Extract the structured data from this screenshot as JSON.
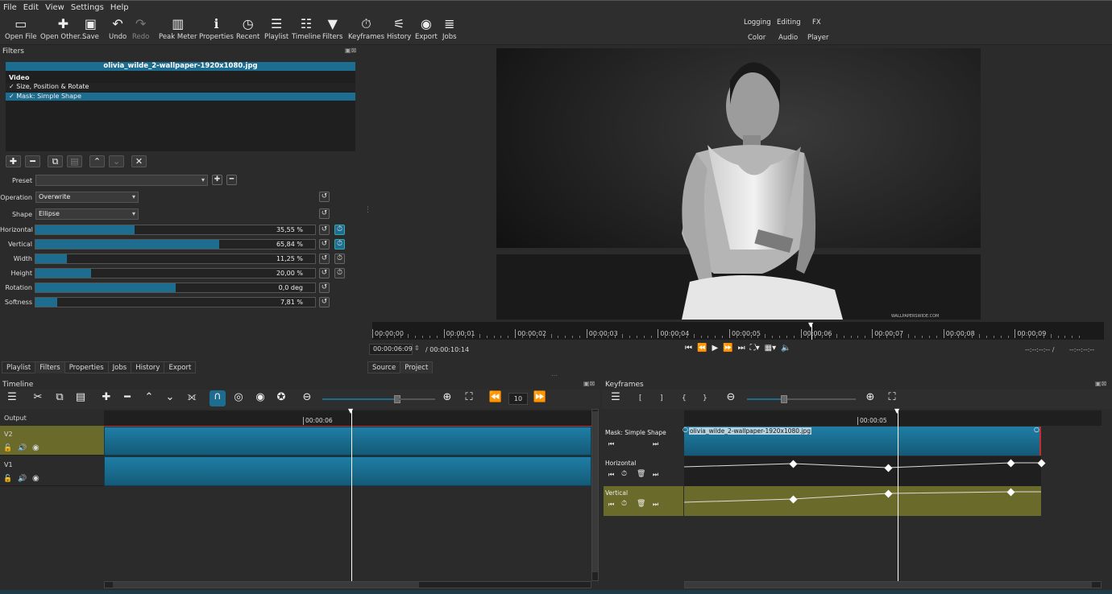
{
  "menu": [
    "File",
    "Edit",
    "View",
    "Settings",
    "Help"
  ],
  "toolbar": [
    {
      "label": "Open File",
      "icon": "open-file-icon"
    },
    {
      "label": "Open Other...",
      "icon": "open-other-icon"
    },
    {
      "label": "Save",
      "icon": "save-icon"
    },
    {
      "label": "Undo",
      "icon": "undo-icon"
    },
    {
      "label": "Redo",
      "icon": "redo-icon"
    },
    {
      "label": "Peak Meter",
      "icon": "peak-meter-icon"
    },
    {
      "label": "Properties",
      "icon": "info-icon"
    },
    {
      "label": "Recent",
      "icon": "clock-icon"
    },
    {
      "label": "Playlist",
      "icon": "playlist-icon"
    },
    {
      "label": "Timeline",
      "icon": "timeline-icon"
    },
    {
      "label": "Filters",
      "icon": "filter-icon"
    },
    {
      "label": "Keyframes",
      "icon": "stopwatch-icon"
    },
    {
      "label": "History",
      "icon": "history-icon"
    },
    {
      "label": "Export",
      "icon": "export-icon"
    },
    {
      "label": "Jobs",
      "icon": "jobs-icon"
    }
  ],
  "workspaces": {
    "row1": [
      "Logging",
      "Editing",
      "FX"
    ],
    "row2": [
      "Color",
      "Audio",
      "Player"
    ]
  },
  "filters": {
    "title": "Filters",
    "clip_name": "olivia_wilde_2-wallpaper-1920x1080.jpg",
    "section": "Video",
    "items": [
      {
        "label": "Size, Position & Rotate",
        "checked": true
      },
      {
        "label": "Mask: Simple Shape",
        "checked": true
      }
    ],
    "preset_label": "Preset",
    "preset_value": "",
    "operation_label": "Operation",
    "operation_value": "Overwrite",
    "shape_label": "Shape",
    "shape_value": "Ellipse",
    "sliders": [
      {
        "label": "Horizontal",
        "value": "35,55 %",
        "level": 0.3555,
        "keyframed": true
      },
      {
        "label": "Vertical",
        "value": "65,84 %",
        "level": 0.6584,
        "keyframed": true
      },
      {
        "label": "Width",
        "value": "11,25 %",
        "level": 0.1125,
        "keyframed": false
      },
      {
        "label": "Height",
        "value": "20,00 %",
        "level": 0.2,
        "keyframed": false
      },
      {
        "label": "Rotation",
        "value": "0,0 deg",
        "level": 0.5,
        "keyframed": null
      },
      {
        "label": "Softness",
        "value": "7,81 %",
        "level": 0.0781,
        "keyframed": null
      }
    ]
  },
  "left_tabs": [
    "Playlist",
    "Filters",
    "Properties",
    "Jobs",
    "History",
    "Export"
  ],
  "left_tab_active": "Filters",
  "player": {
    "ruler": [
      "00:00:00",
      "00:00:01",
      "00:00:02",
      "00:00:03",
      "00:00:04",
      "00:00:05",
      "00:00:06",
      "00:00:07",
      "00:00:08",
      "00:00:09"
    ],
    "position": "00:00:06:09",
    "duration": "/ 00:00:10:14",
    "in_point": "--:--:--:-- /",
    "out_point": "--:--:--:--",
    "tabs": [
      "Source",
      "Project"
    ],
    "watermark": "WALLPAPERSWIDE.COM"
  },
  "timeline": {
    "title": "Timeline",
    "zoom_value": "10",
    "output_label": "Output",
    "timecode": "00:00:06",
    "tracks": [
      "V2",
      "V1"
    ]
  },
  "keyframes": {
    "title": "Keyframes",
    "timecode": "00:00:05",
    "brackets": [
      "[",
      "]",
      "{",
      "}"
    ],
    "filter_name": "Mask: Simple Shape",
    "clip_label": "olivia_wilde_2-wallpaper-1920x1080.jpg",
    "params": [
      "Horizontal",
      "Vertical"
    ]
  },
  "colors": {
    "accent": "#1d6d91",
    "track_selected": "#6a6a2a",
    "clip": "#1f7ea6"
  }
}
